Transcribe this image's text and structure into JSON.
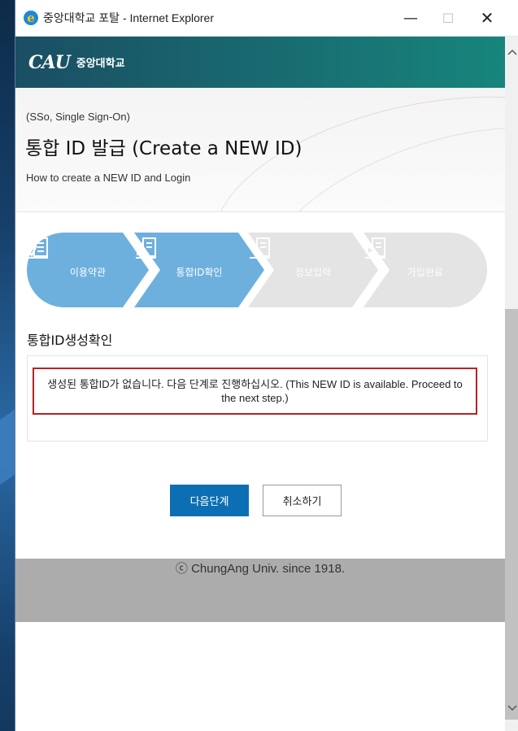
{
  "window": {
    "title": "중앙대학교 포탈 - Internet Explorer",
    "controls": {
      "minimize": "—",
      "maximize": "☐",
      "close": "✕"
    }
  },
  "brand": {
    "logo_text": "CAU",
    "name": "중앙대학교",
    "colors": {
      "bar_start": "#1a4e63",
      "bar_end": "#17857c"
    }
  },
  "header": {
    "sso_label": "(SSo, Single Sign-On)",
    "title": "통합 ID 발급 (Create a NEW ID)",
    "subtitle": "How to create a NEW ID and Login"
  },
  "steps": [
    {
      "label": "이용약관",
      "icon": "checklist-icon",
      "state": "active",
      "color": "#6db0de"
    },
    {
      "label": "통합ID확인",
      "icon": "lock-document-icon",
      "state": "active",
      "color": "#6db0de"
    },
    {
      "label": "정보입력",
      "icon": "edit-document-icon",
      "state": "inactive",
      "color": "#e4e4e4"
    },
    {
      "label": "가입완료",
      "icon": "complete-document-icon",
      "state": "inactive",
      "color": "#e4e4e4"
    }
  ],
  "section": {
    "title": "통합ID생성확인",
    "message": "생성된 통합ID가 없습니다. 다음 단계로 진행하십시오. (This NEW ID is available. Proceed to the next step.)",
    "message_border_color": "#b82222"
  },
  "buttons": {
    "next": "다음단계",
    "cancel": "취소하기",
    "next_color": "#0c6fb3"
  },
  "footer": {
    "text": "ⓒ ChungAng Univ. since 1918."
  },
  "scrollbar": {
    "up": "^",
    "down": "v"
  }
}
